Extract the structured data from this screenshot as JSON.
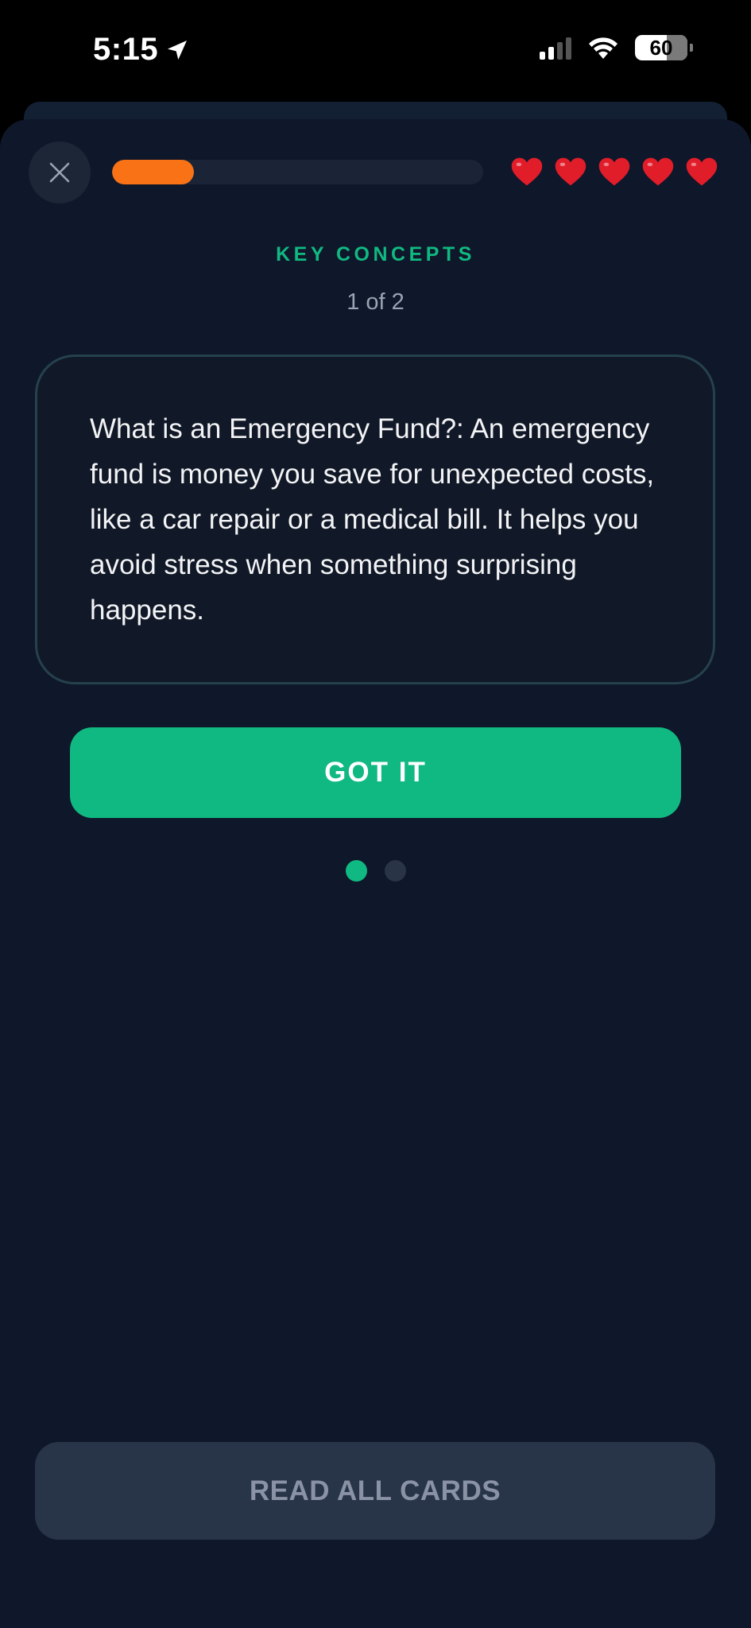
{
  "status_bar": {
    "time": "5:15",
    "battery": "60",
    "icons": [
      "location-arrow-icon",
      "signal-icon",
      "wifi-icon",
      "battery-icon"
    ]
  },
  "header": {
    "close_icon": "close-icon",
    "progress_fraction": 0.22,
    "progress_color": "#f97316",
    "lives": 5,
    "heart_icon": "heart-icon",
    "heart_color": "#e11d2a"
  },
  "lesson": {
    "section_label": "KEY CONCEPTS",
    "counter": "1 of 2",
    "card_text": "What is an Emergency Fund?: An emergency fund is money you save for unexpected costs, like a car repair or a medical bill. It helps you avoid stress when something surprising happens.",
    "primary_button": "GOT IT",
    "pager": {
      "total": 2,
      "current": 1
    },
    "accent_color": "#10b981"
  },
  "footer": {
    "read_all_button": "READ ALL CARDS"
  }
}
